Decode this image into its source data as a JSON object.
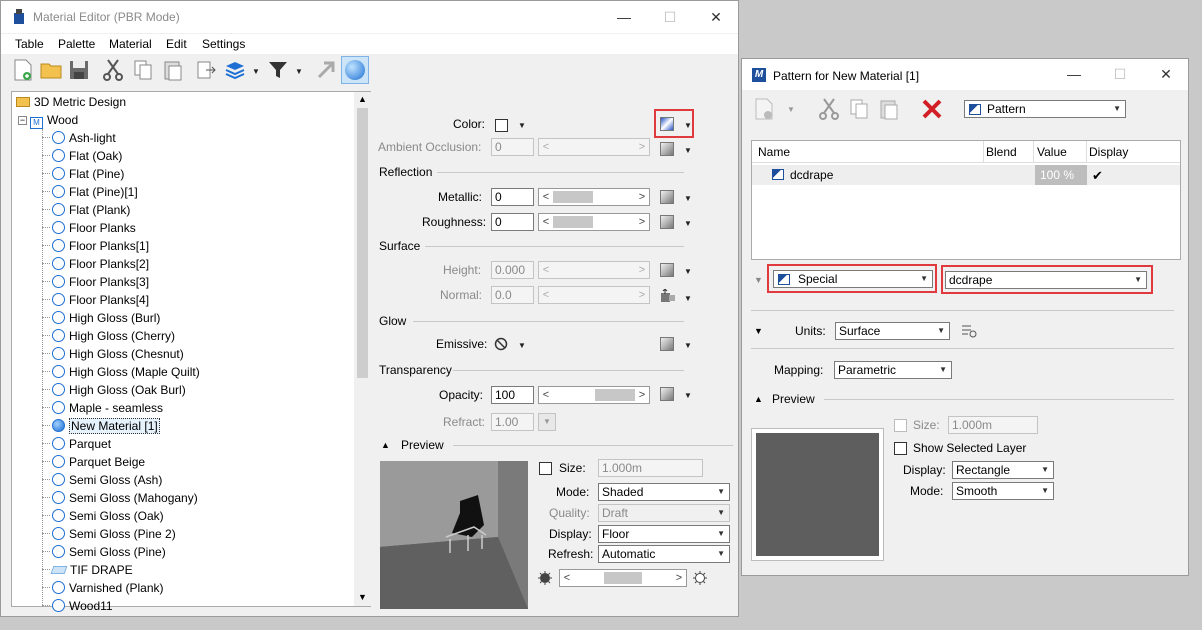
{
  "material_editor": {
    "title": "Material Editor (PBR Mode)",
    "menu": [
      "Table",
      "Palette",
      "Material",
      "Edit",
      "Settings"
    ],
    "tree": {
      "root": "3D Metric Design",
      "group": "Wood",
      "items": [
        "Ash-light",
        "Flat (Oak)",
        "Flat (Pine)",
        "Flat (Pine)[1]",
        "Flat (Plank)",
        "Floor Planks",
        "Floor Planks[1]",
        "Floor Planks[2]",
        "Floor Planks[3]",
        "Floor Planks[4]",
        "High Gloss (Burl)",
        "High Gloss (Cherry)",
        "High Gloss (Chesnut)",
        "High Gloss (Maple Quilt)",
        "High Gloss (Oak Burl)",
        "Maple - seamless",
        "New Material [1]",
        "Parquet",
        "Parquet Beige",
        "Semi Gloss (Ash)",
        "Semi Gloss (Mahogany)",
        "Semi Gloss (Oak)",
        "Semi Gloss (Pine 2)",
        "Semi Gloss (Pine)",
        "TIF DRAPE",
        "Varnished (Plank)",
        "Wood11"
      ],
      "selected": "New Material [1]"
    },
    "props": {
      "color_label": "Color:",
      "ambient_label": "Ambient Occlusion:",
      "ambient_value": "0",
      "reflection_header": "Reflection",
      "metallic_label": "Metallic:",
      "metallic_value": "0",
      "roughness_label": "Roughness:",
      "roughness_value": "0",
      "surface_header": "Surface",
      "height_label": "Height:",
      "height_value": "0.000",
      "normal_label": "Normal:",
      "normal_value": "0.0",
      "glow_header": "Glow",
      "emissive_label": "Emissive:",
      "transparency_header": "Transparency",
      "opacity_label": "Opacity:",
      "opacity_value": "100",
      "refract_label": "Refract:",
      "refract_value": "1.00"
    },
    "preview": {
      "header": "Preview",
      "size_label": "Size:",
      "size_value": "1.000m",
      "mode_label": "Mode:",
      "mode_value": "Shaded",
      "quality_label": "Quality:",
      "quality_value": "Draft",
      "display_label": "Display:",
      "display_value": "Floor",
      "refresh_label": "Refresh:",
      "refresh_value": "Automatic"
    }
  },
  "pattern_window": {
    "title": "Pattern for New Material [1]",
    "toolbar_dropdown": "Pattern",
    "columns": [
      "Name",
      "Blend",
      "Value",
      "Display"
    ],
    "row": {
      "name": "dcdrape",
      "blend": "",
      "value": "100 %",
      "display": "✔"
    },
    "type_value": "Special",
    "file_value": "dcdrape",
    "units_label": "Units:",
    "units_value": "Surface",
    "mapping_label": "Mapping:",
    "mapping_value": "Parametric",
    "preview_header": "Preview",
    "size_label": "Size:",
    "size_value": "1.000m",
    "show_layer_label": "Show Selected Layer",
    "display_label": "Display:",
    "display_value": "Rectangle",
    "mode_label": "Mode:",
    "mode_value": "Smooth"
  },
  "colors": {
    "highlight_red": "#e0393e",
    "accent_blue": "#1d6fd3"
  }
}
